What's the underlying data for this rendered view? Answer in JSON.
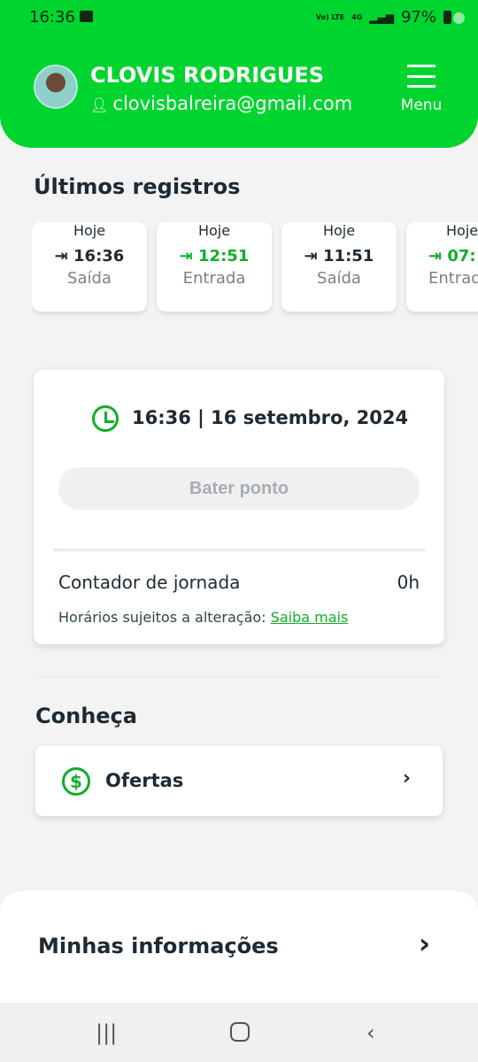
{
  "status_bar": {
    "time": "16:36",
    "network": "Vo) LTE",
    "signal_type": "4G",
    "battery": "97%"
  },
  "header": {
    "name": "CLOVIS RODRIGUES",
    "email": "clovisbalreira@gmail.com",
    "menu_label": "Menu",
    "brand_color": "#00d42f"
  },
  "recent": {
    "title": "Últimos registros",
    "items": [
      {
        "time": "16:36",
        "type": "Saída",
        "day": "Hoje",
        "icon": "exit-icon"
      },
      {
        "time": "12:51",
        "type": "Entrada",
        "day": "Hoje",
        "icon": "enter-icon"
      },
      {
        "time": "11:51",
        "type": "Saída",
        "day": "Hoje",
        "icon": "exit-icon"
      },
      {
        "time": "07:",
        "type": "Entrada",
        "day": "Hoje",
        "icon": "enter-icon"
      }
    ]
  },
  "clock_card": {
    "datetime": "16:36 | 16 setembro, 2024",
    "button": "Bater ponto",
    "counter_label": "Contador de jornada",
    "counter_value": "0h",
    "note": "Horários sujeitos a alteração:",
    "note_link": "Saiba mais"
  },
  "conheca": {
    "title": "Conheça",
    "offers": "Ofertas"
  },
  "info": {
    "label": "Minhas informações"
  }
}
